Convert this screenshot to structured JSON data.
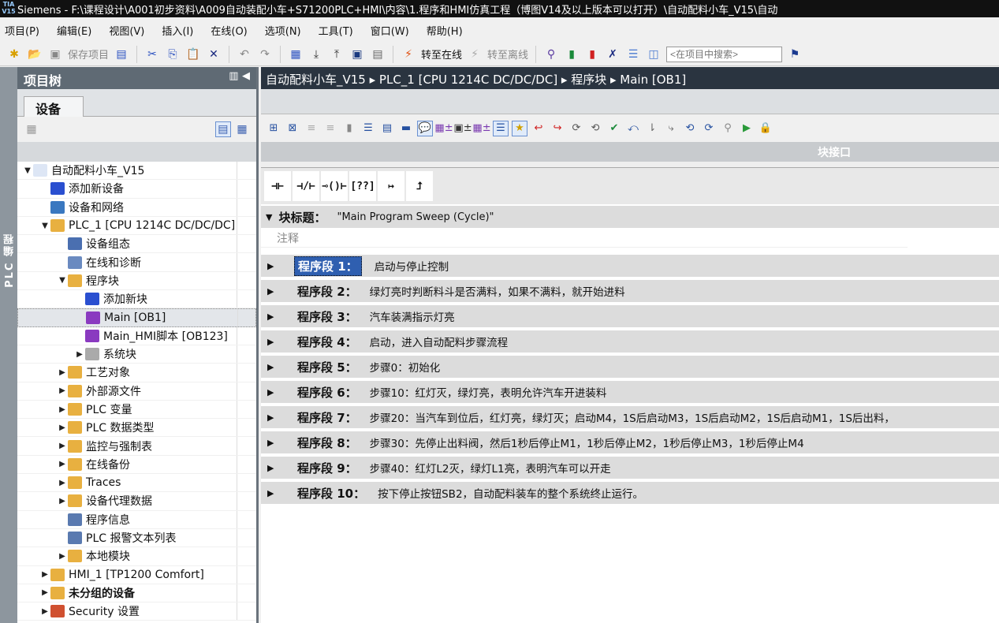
{
  "title": "Siemens  -  F:\\课程设计\\A001初步资料\\A009自动装配小车+S71200PLC+HMI\\内容\\1.程序和HMI仿真工程（博图V14及以上版本可以打开）\\自动配料小车_V15\\自动",
  "menu": [
    "项目(P)",
    "编辑(E)",
    "视图(V)",
    "插入(I)",
    "在线(O)",
    "选项(N)",
    "工具(T)",
    "窗口(W)",
    "帮助(H)"
  ],
  "toolbar": {
    "save": "保存项目",
    "online": "转至在线",
    "offline": "转至离线",
    "search_placeholder": "<在项目中搜索>"
  },
  "side_strip": "PLC 编程",
  "tree": {
    "title": "项目树",
    "tab": "设备",
    "items": [
      {
        "label": "自动配料小车_V15",
        "level": 0,
        "arrow": "▼",
        "color": "#dde6f5"
      },
      {
        "label": "添加新设备",
        "level": 1,
        "arrow": "",
        "color": "#2a4fd0"
      },
      {
        "label": "设备和网络",
        "level": 1,
        "arrow": "",
        "color": "#3a78c0"
      },
      {
        "label": "PLC_1 [CPU 1214C DC/DC/DC]",
        "level": 1,
        "arrow": "▼",
        "color": "#e8b040"
      },
      {
        "label": "设备组态",
        "level": 2,
        "arrow": "",
        "color": "#4a6fb0"
      },
      {
        "label": "在线和诊断",
        "level": 2,
        "arrow": "",
        "color": "#6a8ac0"
      },
      {
        "label": "程序块",
        "level": 2,
        "arrow": "▼",
        "color": "#e8b040"
      },
      {
        "label": "添加新块",
        "level": 3,
        "arrow": "",
        "color": "#2a4fd0"
      },
      {
        "label": "Main [OB1]",
        "level": 3,
        "arrow": "",
        "color": "#8a3ac0",
        "selected": true
      },
      {
        "label": "Main_HMI脚本 [OB123]",
        "level": 3,
        "arrow": "",
        "color": "#8a3ac0"
      },
      {
        "label": "系统块",
        "level": 3,
        "arrow": "▶",
        "color": "#aaaaaa"
      },
      {
        "label": "工艺对象",
        "level": 2,
        "arrow": "▶",
        "color": "#e8b040"
      },
      {
        "label": "外部源文件",
        "level": 2,
        "arrow": "▶",
        "color": "#e8b040"
      },
      {
        "label": "PLC 变量",
        "level": 2,
        "arrow": "▶",
        "color": "#e8b040"
      },
      {
        "label": "PLC 数据类型",
        "level": 2,
        "arrow": "▶",
        "color": "#e8b040"
      },
      {
        "label": "监控与强制表",
        "level": 2,
        "arrow": "▶",
        "color": "#e8b040"
      },
      {
        "label": "在线备份",
        "level": 2,
        "arrow": "▶",
        "color": "#e8b040"
      },
      {
        "label": "Traces",
        "level": 2,
        "arrow": "▶",
        "color": "#e8b040"
      },
      {
        "label": "设备代理数据",
        "level": 2,
        "arrow": "▶",
        "color": "#e8b040"
      },
      {
        "label": "程序信息",
        "level": 2,
        "arrow": "",
        "color": "#5a7ab0"
      },
      {
        "label": "PLC 报警文本列表",
        "level": 2,
        "arrow": "",
        "color": "#5a7ab0"
      },
      {
        "label": "本地模块",
        "level": 2,
        "arrow": "▶",
        "color": "#e8b040"
      },
      {
        "label": "HMI_1 [TP1200 Comfort]",
        "level": 1,
        "arrow": "▶",
        "color": "#e8b040"
      },
      {
        "label": "未分组的设备",
        "level": 1,
        "arrow": "▶",
        "color": "#e8b040",
        "bold": true
      },
      {
        "label": "Security 设置",
        "level": 1,
        "arrow": "▶",
        "color": "#d05030"
      }
    ]
  },
  "editor": {
    "breadcrumb": "自动配料小车_V15  ▸  PLC_1 [CPU 1214C DC/DC/DC]  ▸  程序块  ▸  Main [OB1]",
    "interface_label": "块接口",
    "instructions": [
      "⊣⊢",
      "⊣/⊢",
      "⊸()⊢",
      "[??]",
      "↦",
      "⮥"
    ],
    "block_title_label": "块标题：",
    "block_title": "\"Main Program Sweep (Cycle)\"",
    "comment_placeholder": "注释",
    "networks": [
      {
        "label": "程序段 1：",
        "text": "启动与停止控制"
      },
      {
        "label": "程序段 2：",
        "text": "绿灯亮时判断料斗是否满料，如果不满料，就开始进料"
      },
      {
        "label": "程序段 3：",
        "text": "汽车装满指示灯亮"
      },
      {
        "label": "程序段 4：",
        "text": "启动，进入自动配料步骤流程"
      },
      {
        "label": "程序段 5：",
        "text": "步骤0：初始化"
      },
      {
        "label": "程序段 6：",
        "text": "步骤10：红灯灭，绿灯亮，表明允许汽车开进装料"
      },
      {
        "label": "程序段 7：",
        "text": "步骤20：当汽车到位后，红灯亮，绿灯灭；启动M4，1S后启动M3，1S后启动M2，1S后启动M1，1S后出料，"
      },
      {
        "label": "程序段 8：",
        "text": "步骤30：先停止出料阀，然后1秒后停止M1，1秒后停止M2，1秒后停止M3，1秒后停止M4"
      },
      {
        "label": "程序段 9：",
        "text": "步骤40：红灯L2灭，绿灯L1亮，表明汽车可以开走"
      },
      {
        "label": "程序段 10：",
        "text": "按下停止按钮SB2，自动配料装车的整个系统终止运行。"
      }
    ]
  }
}
